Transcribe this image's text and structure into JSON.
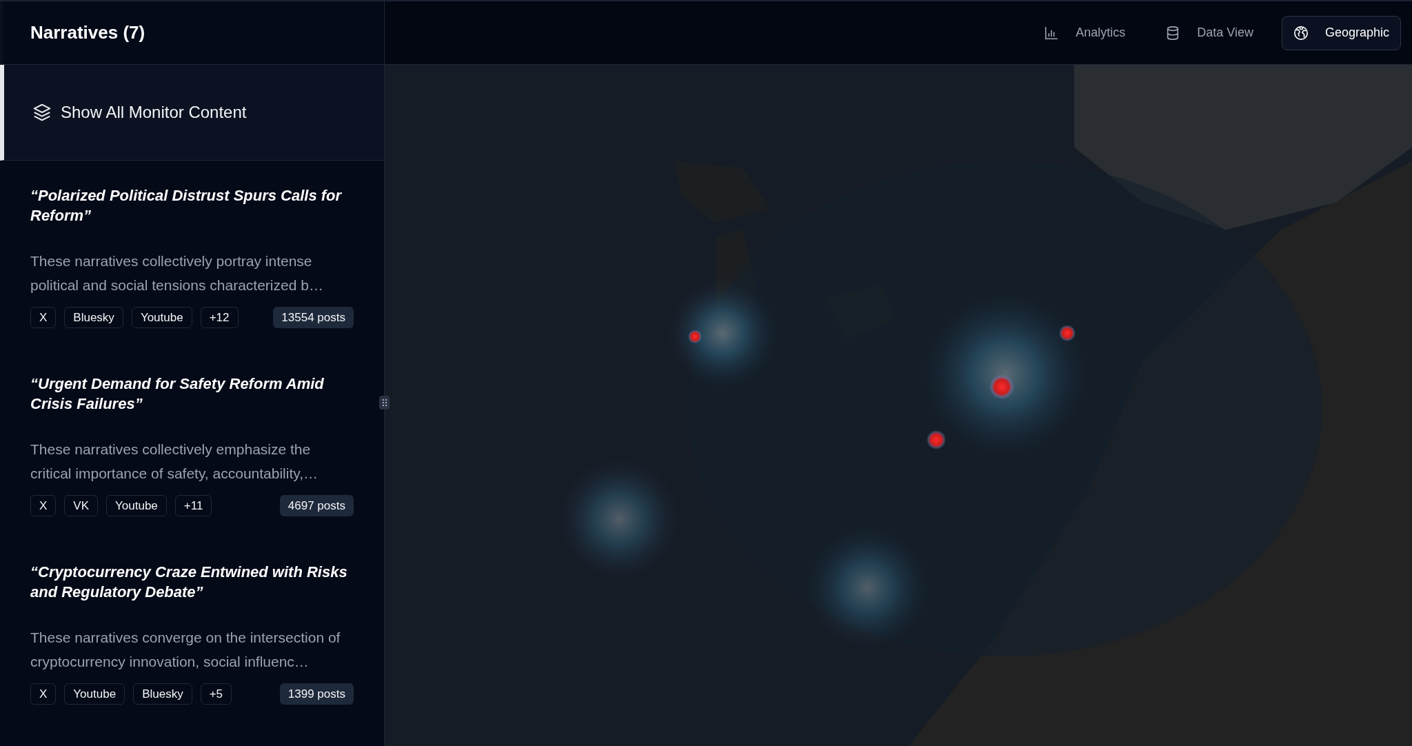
{
  "sidebar": {
    "title": "Narratives (7)",
    "show_all": {
      "label": "Show All Monitor Content",
      "selected": true
    },
    "narratives": [
      {
        "title": "“Polarized Political Distrust Spurs Calls for Reform”",
        "description": "These narratives collectively portray intense political and social tensions characterized b…",
        "platforms": [
          "X",
          "Bluesky",
          "Youtube",
          "+12"
        ],
        "posts": "13554 posts"
      },
      {
        "title": "“Urgent Demand for Safety Reform Amid Crisis Failures”",
        "description": "These narratives collectively emphasize the critical importance of safety, accountability,…",
        "platforms": [
          "X",
          "VK",
          "Youtube",
          "+11"
        ],
        "posts": "4697 posts"
      },
      {
        "title": "“Cryptocurrency Craze Entwined with Risks and Regulatory Debate”",
        "description": "These narratives converge on the intersection of cryptocurrency innovation, social influenc…",
        "platforms": [
          "X",
          "Youtube",
          "Bluesky",
          "+5"
        ],
        "posts": "1399 posts"
      }
    ]
  },
  "view_tabs": [
    {
      "label": "Analytics",
      "kind": "chart",
      "selected": false
    },
    {
      "label": "Data View",
      "kind": "database",
      "selected": false
    },
    {
      "label": "Geographic",
      "kind": "globe",
      "selected": true
    }
  ]
}
